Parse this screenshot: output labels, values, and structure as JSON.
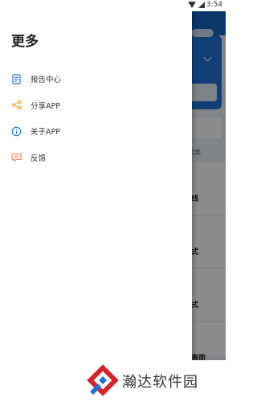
{
  "status_bar": {
    "time": "3:54",
    "icons": [
      "wifi-icon",
      "signal-icon"
    ]
  },
  "drawer": {
    "title": "更多",
    "items": [
      {
        "label": "报告中心",
        "icon": "report-icon",
        "color": "#1e74d6"
      },
      {
        "label": "分享APP",
        "icon": "share-icon",
        "color": "#f5a623"
      },
      {
        "label": "关于APP",
        "icon": "info-icon",
        "color": "#1e74d6"
      },
      {
        "label": "反馈",
        "icon": "feedback-icon",
        "color": "#f07c4a"
      }
    ]
  },
  "background": {
    "section_label": "反防类",
    "rows": [
      "线",
      "式",
      "式",
      "表面"
    ],
    "accent_color": "#1e74d6"
  },
  "watermark": {
    "text": "瀚达软件园"
  }
}
